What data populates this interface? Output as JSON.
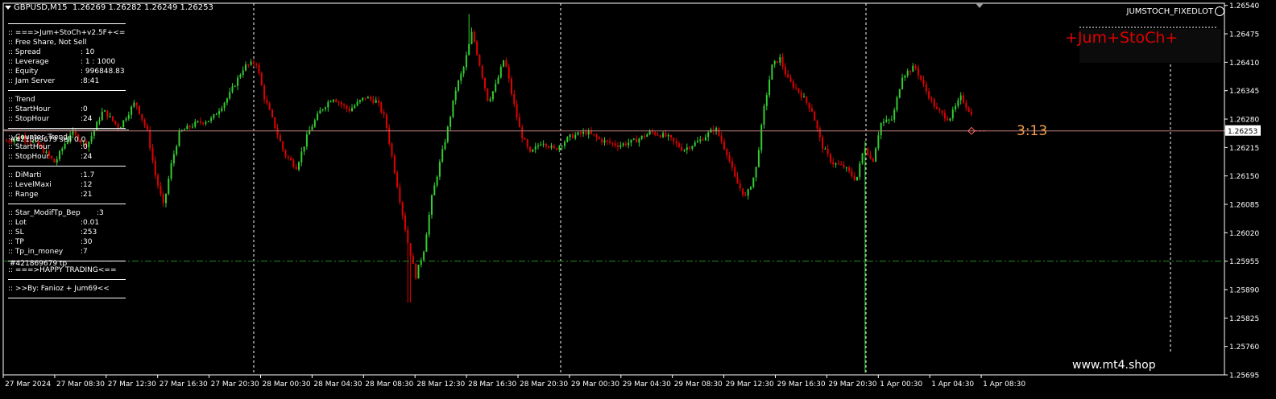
{
  "header": {
    "symbol": "GBPUSD,M15",
    "ohlc": "1.26269 1.26282 1.26249 1.26253",
    "ea_name": "JUMSTOCH_FIXEDLOT"
  },
  "panel": {
    "rows": [
      {
        "type": "sep"
      },
      {
        "type": "text",
        "label": ":: ===>Jum+StoCh+v2.5F+<==="
      },
      {
        "type": "text",
        "label": ":: Free Share, Not Sell"
      },
      {
        "type": "kv",
        "label": ":: Spread",
        "value": ": 10"
      },
      {
        "type": "kv",
        "label": ":: Leverage",
        "value": ": 1 : 1000"
      },
      {
        "type": "kv",
        "label": ":: Equity",
        "value": ": 996848.83"
      },
      {
        "type": "kv",
        "label": ":: Jam Server",
        "value": ":8:41"
      },
      {
        "type": "sep"
      },
      {
        "type": "text",
        "label": ":: Trend"
      },
      {
        "type": "kv",
        "label": ":: StartHour",
        "value": ":0"
      },
      {
        "type": "kv",
        "label": ":: StopHour",
        "value": ":24"
      },
      {
        "type": "sep"
      },
      {
        "type": "text",
        "label": ":: Counter_Trend"
      },
      {
        "type": "kv",
        "label": ":: StartHour",
        "value": ":0"
      },
      {
        "type": "kv",
        "label": ":: StopHour",
        "value": ":24"
      },
      {
        "type": "sep"
      },
      {
        "type": "kv",
        "label": ":: DiMarti",
        "value": ":1.7"
      },
      {
        "type": "kv",
        "label": ":: LevelMaxi",
        "value": ":12"
      },
      {
        "type": "kv",
        "label": ":: Range",
        "value": ":21"
      },
      {
        "type": "sep"
      },
      {
        "type": "kv",
        "label": ":: Star_ModifTp_Bep",
        "value": ":3"
      },
      {
        "type": "kv",
        "label": ":: Lot",
        "value": ":0.01"
      },
      {
        "type": "kv",
        "label": ":: SL",
        "value": ":253"
      },
      {
        "type": "kv",
        "label": ":: TP",
        "value": ":30"
      },
      {
        "type": "kv",
        "label": ":: Tp_in_money",
        "value": ":7"
      },
      {
        "type": "sep"
      },
      {
        "type": "text",
        "label": ":: ===>HAPPY TRADING<=="
      },
      {
        "type": "sep"
      },
      {
        "type": "text",
        "label": ":: >>By: Fanioz + Jum69<<"
      },
      {
        "type": "sep"
      }
    ]
  },
  "order_labels": {
    "sell": "#421869679 sell 0.0",
    "tp": "#421869679 tp"
  },
  "brand": {
    "text": "+Jum+StoCh+",
    "dots": "::::                ::::"
  },
  "timer": "3:13",
  "site": "www.mt4.shop",
  "colors": {
    "background": "#000000",
    "bull": "#32cd32",
    "bear": "#e00000",
    "grid": "#ffffff",
    "bid_line": "#c08080",
    "tp_line": "#228b22",
    "timer": "#f5a04a"
  },
  "chart_data": {
    "type": "candlestick",
    "symbol": "GBPUSD",
    "timeframe": "M15",
    "ylim": [
      1.25695,
      1.26545
    ],
    "y_ticks": [
      "1.26540",
      "1.26475",
      "1.26410",
      "1.26345",
      "1.26280",
      "1.26253",
      "1.26215",
      "1.26150",
      "1.26085",
      "1.26020",
      "1.25955",
      "1.25890",
      "1.25825",
      "1.25760",
      "1.25695"
    ],
    "current_price": "1.26253",
    "x_ticks": [
      "27 Mar 2024",
      "27 Mar 08:30",
      "27 Mar 12:30",
      "27 Mar 16:30",
      "27 Mar 20:30",
      "28 Mar 00:30",
      "28 Mar 04:30",
      "28 Mar 08:30",
      "28 Mar 12:30",
      "28 Mar 16:30",
      "28 Mar 20:30",
      "29 Mar 00:30",
      "29 Mar 04:30",
      "29 Mar 08:30",
      "29 Mar 12:30",
      "29 Mar 16:30",
      "29 Mar 20:30",
      "1 Apr 00:30",
      "1 Apr 04:30",
      "1 Apr 08:30"
    ],
    "bid_line_price": 1.26253,
    "tp_line_price": 1.25955,
    "price_path": [
      [
        0,
        1.2623
      ],
      [
        20,
        1.2624
      ],
      [
        40,
        1.2622
      ],
      [
        60,
        1.2618
      ],
      [
        80,
        1.2625
      ],
      [
        100,
        1.2622
      ],
      [
        120,
        1.263
      ],
      [
        140,
        1.2626
      ],
      [
        160,
        1.2632
      ],
      [
        175,
        1.2625
      ],
      [
        185,
        1.2615
      ],
      [
        195,
        1.2608
      ],
      [
        205,
        1.2618
      ],
      [
        215,
        1.2625
      ],
      [
        235,
        1.2627
      ],
      [
        255,
        1.2628
      ],
      [
        275,
        1.2633
      ],
      [
        295,
        1.264
      ],
      [
        310,
        1.2641
      ],
      [
        320,
        1.2633
      ],
      [
        330,
        1.2628
      ],
      [
        345,
        1.262
      ],
      [
        360,
        1.2617
      ],
      [
        375,
        1.2625
      ],
      [
        390,
        1.263
      ],
      [
        405,
        1.2633
      ],
      [
        425,
        1.263
      ],
      [
        445,
        1.2633
      ],
      [
        460,
        1.2632
      ],
      [
        470,
        1.2628
      ],
      [
        478,
        1.262
      ],
      [
        488,
        1.261
      ],
      [
        498,
        1.26
      ],
      [
        508,
        1.2592
      ],
      [
        518,
        1.2598
      ],
      [
        528,
        1.261
      ],
      [
        538,
        1.2618
      ],
      [
        548,
        1.2626
      ],
      [
        558,
        1.2635
      ],
      [
        568,
        1.264
      ],
      [
        578,
        1.2648
      ],
      [
        588,
        1.264
      ],
      [
        598,
        1.2632
      ],
      [
        608,
        1.2636
      ],
      [
        618,
        1.2642
      ],
      [
        628,
        1.2633
      ],
      [
        638,
        1.2625
      ],
      [
        650,
        1.262
      ],
      [
        665,
        1.2623
      ],
      [
        680,
        1.2621
      ],
      [
        700,
        1.2624
      ],
      [
        720,
        1.2625
      ],
      [
        740,
        1.2623
      ],
      [
        760,
        1.2622
      ],
      [
        780,
        1.2623
      ],
      [
        800,
        1.2625
      ],
      [
        820,
        1.2624
      ],
      [
        840,
        1.2621
      ],
      [
        860,
        1.2623
      ],
      [
        880,
        1.2626
      ],
      [
        895,
        1.262
      ],
      [
        905,
        1.2614
      ],
      [
        918,
        1.261
      ],
      [
        930,
        1.2616
      ],
      [
        940,
        1.263
      ],
      [
        950,
        1.264
      ],
      [
        960,
        1.2642
      ],
      [
        970,
        1.2637
      ],
      [
        985,
        1.2634
      ],
      [
        1000,
        1.263
      ],
      [
        1012,
        1.2622
      ],
      [
        1025,
        1.2618
      ],
      [
        1040,
        1.2617
      ],
      [
        1055,
        1.2614
      ],
      [
        1065,
        1.2622
      ],
      [
        1075,
        1.2618
      ],
      [
        1085,
        1.2627
      ],
      [
        1100,
        1.2628
      ],
      [
        1112,
        1.2638
      ],
      [
        1128,
        1.264
      ],
      [
        1140,
        1.2635
      ],
      [
        1155,
        1.263
      ],
      [
        1170,
        1.2628
      ],
      [
        1185,
        1.2633
      ],
      [
        1195,
        1.263
      ],
      [
        1208,
        1.26253
      ]
    ]
  }
}
